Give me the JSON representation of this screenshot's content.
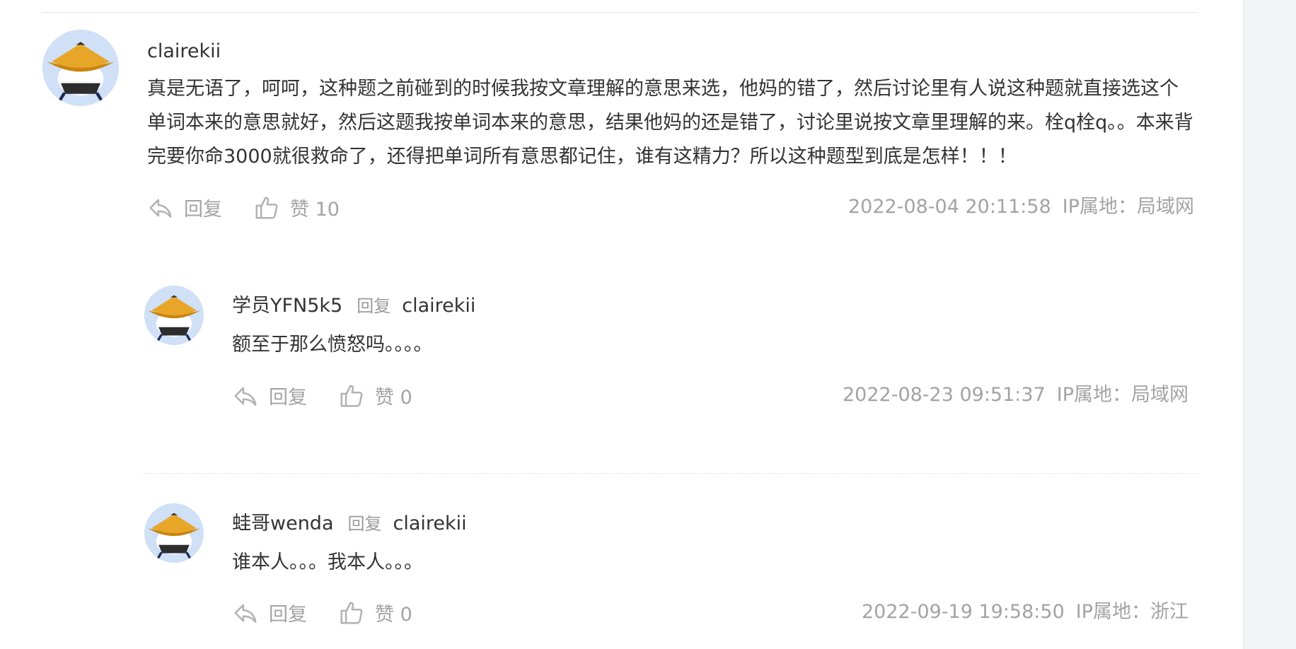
{
  "comments": [
    {
      "username": "clairekii",
      "content": "真是无语了，呵呵，这种题之前碰到的时候我按文章理解的意思来选，他妈的错了，然后讨论里有人说这种题就直接选这个单词本来的意思就好，然后这题我按单词本来的意思，结果他妈的还是错了，讨论里说按文章里理解的来。栓q栓q。。本来背完要你命3000就很救命了，还得把单词所有意思都记住，谁有这精力？所以这种题型到底是怎样！！！",
      "reply_label": "回复",
      "like_label": "赞 10",
      "time": "2022-08-04 20:11:58",
      "ip": "IP属地：局域网"
    }
  ],
  "replies": [
    {
      "username": "学员YFN5k5",
      "reply_word": "回复",
      "reply_to": "clairekii",
      "content": "额至于那么愤怒吗。。。。",
      "reply_label": "回复",
      "like_label": "赞 0",
      "time": "2022-08-23 09:51:37",
      "ip": "IP属地：局域网"
    },
    {
      "username": "蛙哥wenda",
      "reply_word": "回复",
      "reply_to": "clairekii",
      "content": "谁本人。。。我本人。。。",
      "reply_label": "回复",
      "like_label": "赞 0",
      "time": "2022-09-19 19:58:50",
      "ip": "IP属地：浙江"
    }
  ],
  "icons": {
    "avatar": "straw-hat-avatar-icon",
    "reply": "reply-arrow-icon",
    "like": "thumbs-up-icon"
  },
  "colors": {
    "text": "#333333",
    "muted": "#a3a3a3",
    "avatar_bg": "#cfe0f7",
    "hat": "#e8a628",
    "gutter": "#f3f4f6"
  }
}
